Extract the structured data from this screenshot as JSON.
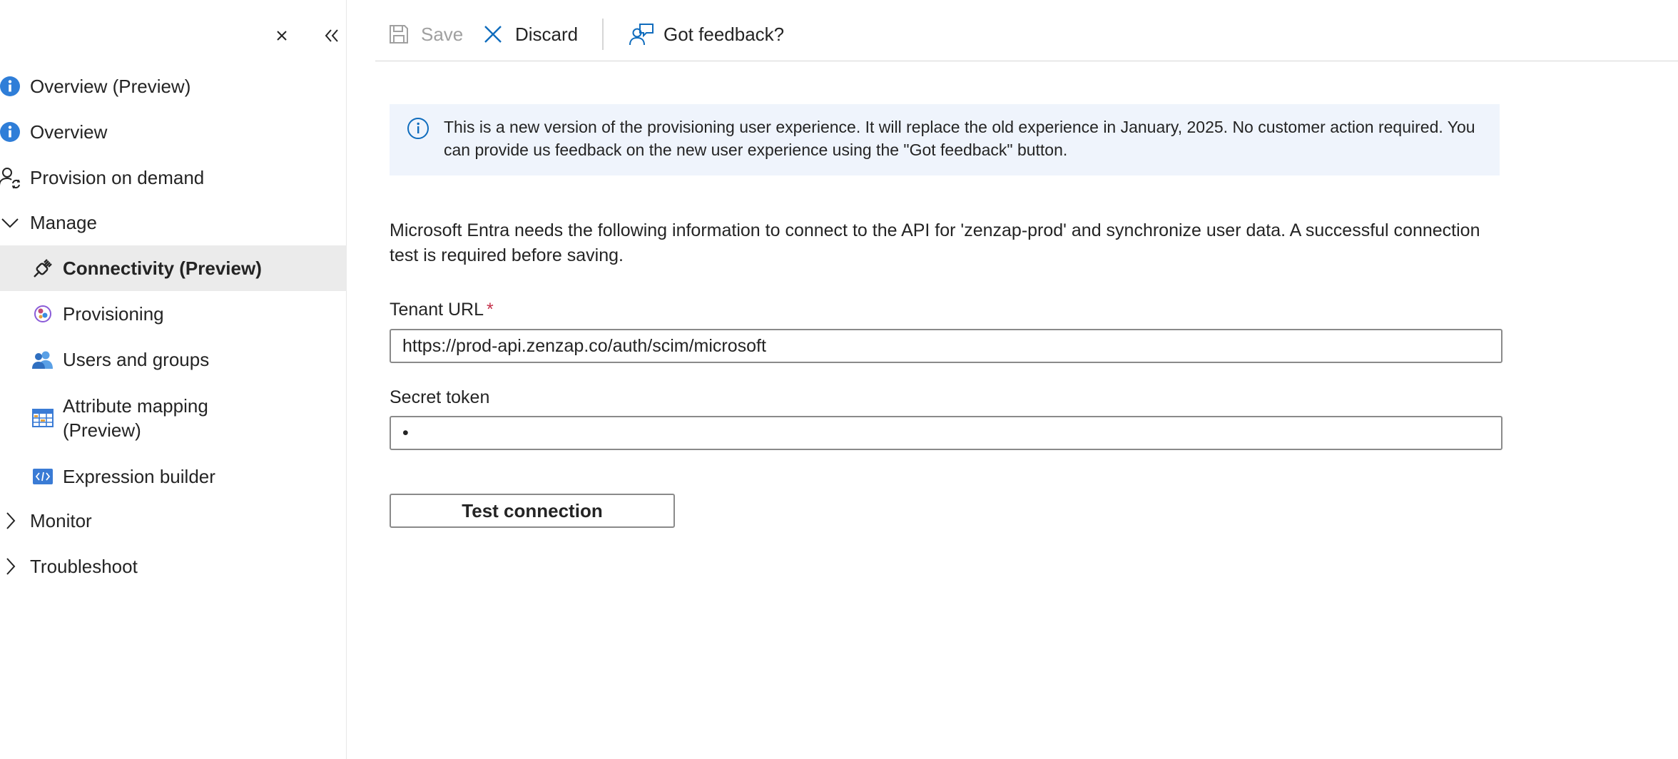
{
  "sidebar": {
    "close_icon": "close-icon",
    "collapse_icon": "double-chevron-left-icon",
    "items": [
      {
        "label": "Overview (Preview)",
        "icon": "info-icon"
      },
      {
        "label": "Overview",
        "icon": "info-icon"
      },
      {
        "label": "Provision on demand",
        "icon": "user-sync-icon"
      },
      {
        "label": "Manage",
        "icon": "chevron-down-icon"
      },
      {
        "label": "Connectivity (Preview)",
        "icon": "plug-icon",
        "active": true
      },
      {
        "label": "Provisioning",
        "icon": "provisioning-icon"
      },
      {
        "label": "Users and groups",
        "icon": "users-icon"
      },
      {
        "label": "Attribute mapping (Preview)",
        "icon": "table-icon"
      },
      {
        "label": "Expression builder",
        "icon": "code-icon"
      },
      {
        "label": "Monitor",
        "icon": "chevron-right-icon"
      },
      {
        "label": "Troubleshoot",
        "icon": "chevron-right-icon"
      }
    ]
  },
  "toolbar": {
    "save_label": "Save",
    "discard_label": "Discard",
    "feedback_label": "Got feedback?"
  },
  "banner": {
    "text": "This is a new version of the provisioning user experience. It will replace the old experience in January, 2025. No customer action required. You can provide us feedback on the new user experience using the \"Got feedback\" button."
  },
  "main": {
    "description": "Microsoft Entra needs the following information to connect to the API for 'zenzap-prod' and synchronize user data. A successful connection test is required before saving.",
    "tenant_url": {
      "label": "Tenant URL",
      "required_mark": "*",
      "value": "https://prod-api.zenzap.co/auth/scim/microsoft"
    },
    "secret_token": {
      "label": "Secret token",
      "value": "•"
    },
    "test_button_label": "Test connection"
  },
  "colors": {
    "accent": "#0f6cbd",
    "banner_bg": "#eff4fc",
    "active_bg": "#ebebeb",
    "required": "#c4314b"
  }
}
